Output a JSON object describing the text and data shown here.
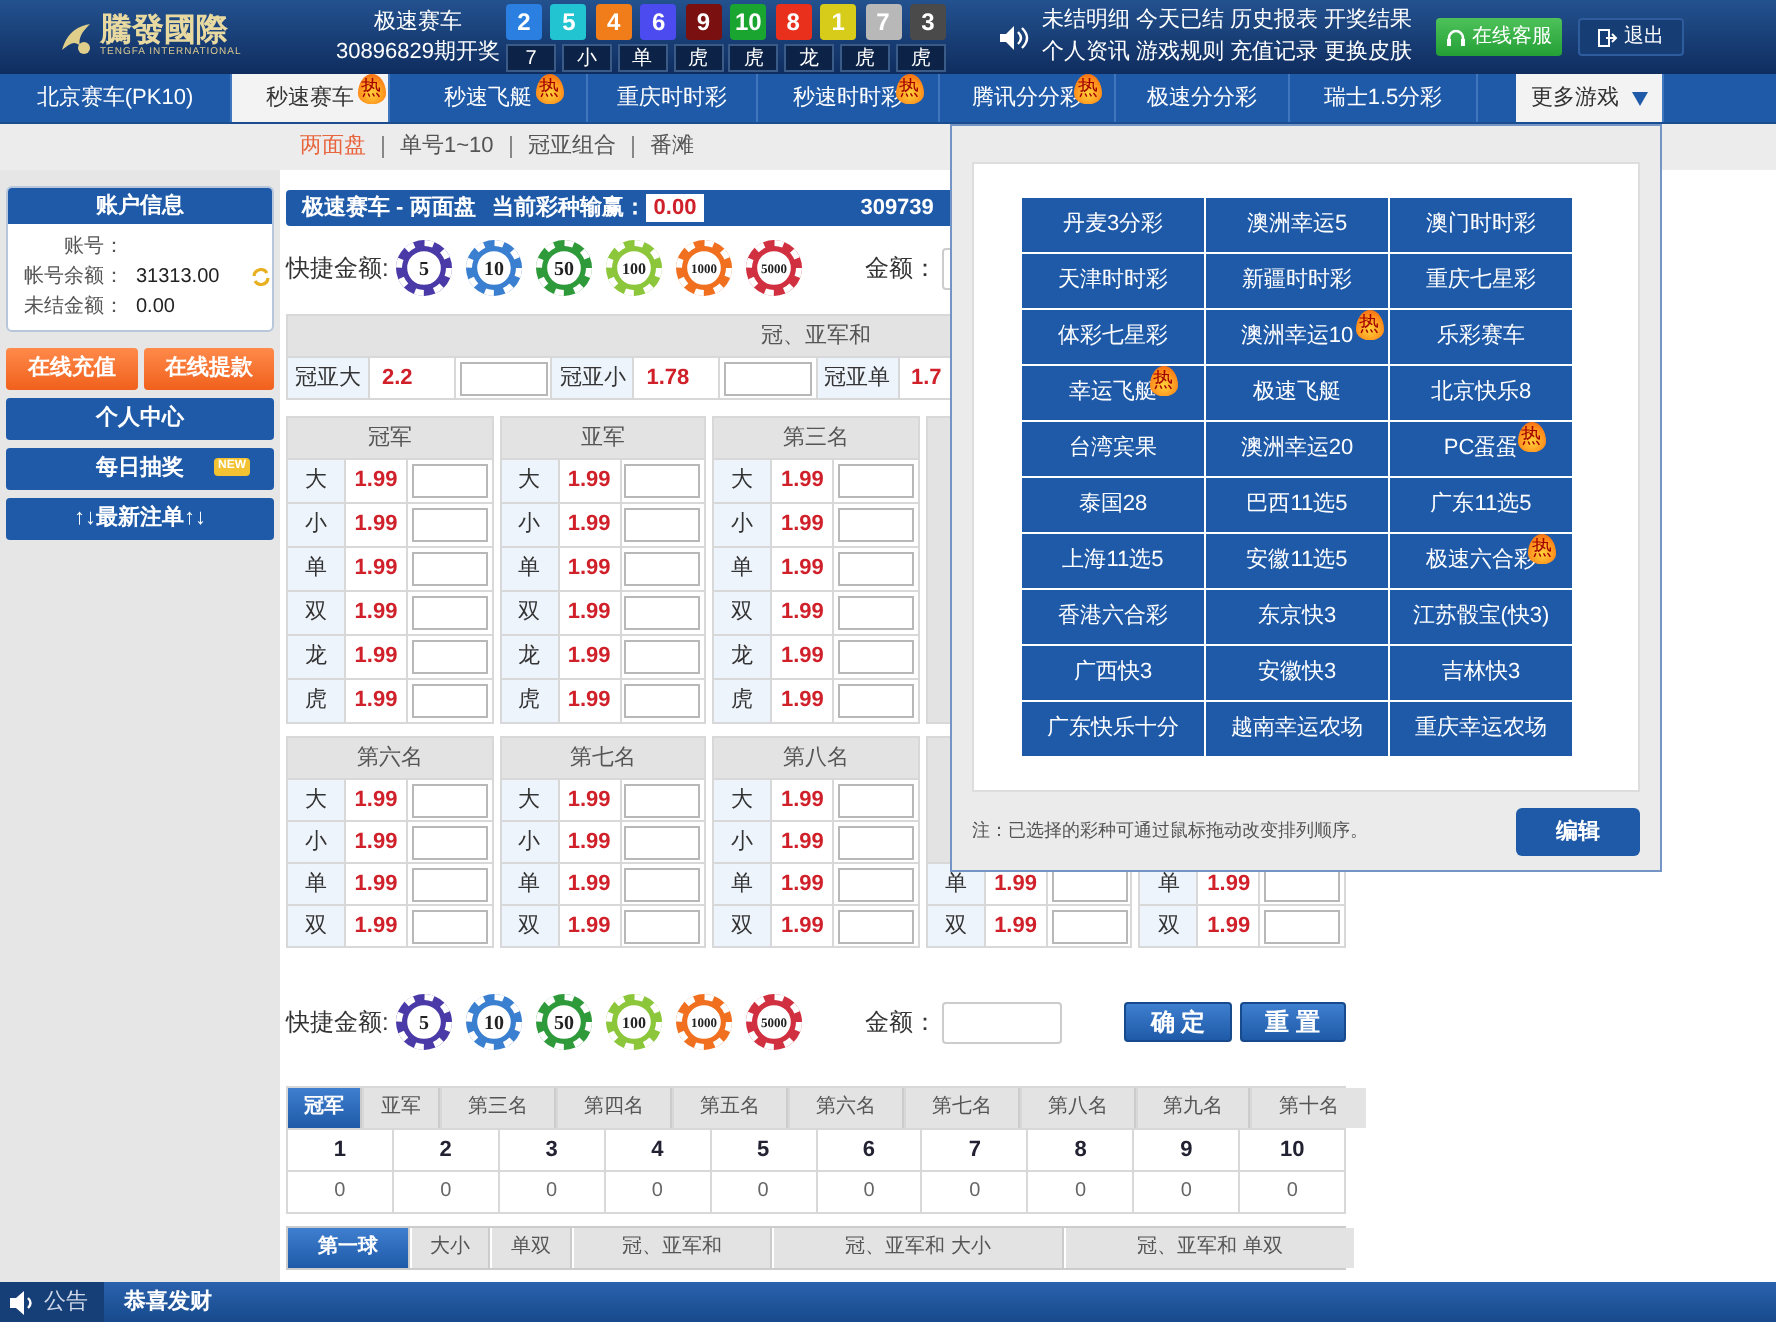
{
  "header": {
    "logo": {
      "name": "騰發國際",
      "subtitle": "TENGFA INTERNATIONAL"
    },
    "draw": {
      "game": "极速赛车",
      "issue": "30896829期开奖"
    },
    "balls": [
      {
        "number": "2",
        "color": "#2b7fe0"
      },
      {
        "number": "5",
        "color": "#22c4d2"
      },
      {
        "number": "4",
        "color": "#f07d1a"
      },
      {
        "number": "6",
        "color": "#4b4bef"
      },
      {
        "number": "9",
        "color": "#7a1010"
      },
      {
        "number": "10",
        "color": "#1aa531"
      },
      {
        "number": "8",
        "color": "#e8301c"
      },
      {
        "number": "1",
        "color": "#d8cc1a"
      },
      {
        "number": "7",
        "color": "#b8b8b8"
      },
      {
        "number": "3",
        "color": "#4a4a4a"
      }
    ],
    "results": [
      "7",
      "小",
      "单",
      "虎",
      "虎",
      "龙",
      "虎",
      "虎"
    ],
    "links": [
      [
        "未结明细",
        "今天已结",
        "历史报表",
        "开奖结果"
      ],
      [
        "个人资讯",
        "游戏规则",
        "充值记录",
        "更换皮肤"
      ]
    ],
    "buttons": [
      {
        "label": "在线客服",
        "kind": "support"
      },
      {
        "label": "退出",
        "kind": "logout"
      }
    ]
  },
  "nav": {
    "tabs": [
      {
        "label": "北京赛车(PK10)",
        "selected": false
      },
      {
        "label": "秒速赛车",
        "selected": true,
        "badge": "热"
      },
      {
        "label": "秒速飞艇",
        "selected": false,
        "badge": "热"
      },
      {
        "label": "重庆时时彩",
        "selected": false
      },
      {
        "label": "秒速时时彩",
        "selected": false,
        "badge": "热"
      },
      {
        "label": "腾讯分分彩",
        "selected": false,
        "badge": "热"
      },
      {
        "label": "极速分分彩",
        "selected": false
      },
      {
        "label": "瑞士1.5分彩",
        "selected": false
      }
    ],
    "more": {
      "label": "更多游戏",
      "expanded": true
    }
  },
  "subnav": [
    {
      "label": "两面盘",
      "selected": true
    },
    {
      "label": "单号1~10",
      "selected": false
    },
    {
      "label": "冠亚组合",
      "selected": false
    },
    {
      "label": "番滩",
      "selected": false
    }
  ],
  "account": {
    "title": "账户信息",
    "rows": [
      {
        "label": "账号："
      },
      {
        "label": "帐号余额：",
        "value": "31313.00",
        "refresh": true
      },
      {
        "label": "未结金额：",
        "value": "0.00"
      }
    ]
  },
  "sidebar_buttons": [
    {
      "label": "在线充值",
      "kind": "accent"
    },
    {
      "label": "在线提款",
      "kind": "accent"
    },
    {
      "label": "个人中心",
      "kind": "menu"
    },
    {
      "label": "每日抽奖",
      "kind": "menu",
      "badge": "NEW"
    },
    {
      "label": "↑↓最新注单↑↓",
      "kind": "menu"
    }
  ],
  "panel": {
    "title": "极速赛车 - 两面盘",
    "winloss_label": "当前彩种输赢：",
    "winloss": "0.00",
    "issue": "309739"
  },
  "quick_top": {
    "label": "快捷金额:",
    "amount_label": "金额：",
    "chips": [
      {
        "value": "5",
        "color": "#4a3aa8"
      },
      {
        "value": "10",
        "color": "#3a7fd0"
      },
      {
        "value": "50",
        "color": "#2e9a3a"
      },
      {
        "value": "100",
        "color": "#8cc63a"
      },
      {
        "value": "1000",
        "color": "#f07020"
      },
      {
        "value": "5000",
        "color": "#d03040"
      }
    ]
  },
  "sum_table": {
    "title": "冠、亚军和",
    "cells": [
      {
        "label": "冠亚大",
        "odds": "2.2"
      },
      {
        "label": "冠亚小",
        "odds": "1.78"
      },
      {
        "label": "冠亚单",
        "odds": "1.7"
      }
    ]
  },
  "groups": [
    {
      "tables": [
        {
          "title": "冠军",
          "rows": [
            {
              "label": "大",
              "odds": "1.99"
            },
            {
              "label": "小",
              "odds": "1.99"
            },
            {
              "label": "单",
              "odds": "1.99"
            },
            {
              "label": "双",
              "odds": "1.99"
            },
            {
              "label": "龙",
              "odds": "1.99"
            },
            {
              "label": "虎",
              "odds": "1.99"
            }
          ]
        },
        {
          "title": "亚军",
          "rows": [
            {
              "label": "大",
              "odds": "1.99"
            },
            {
              "label": "小",
              "odds": "1.99"
            },
            {
              "label": "单",
              "odds": "1.99"
            },
            {
              "label": "双",
              "odds": "1.99"
            },
            {
              "label": "龙",
              "odds": "1.99"
            },
            {
              "label": "虎",
              "odds": "1.99"
            }
          ]
        },
        {
          "title": "第三名",
          "rows": [
            {
              "label": "大",
              "odds": "1.99"
            },
            {
              "label": "小",
              "odds": "1.99"
            },
            {
              "label": "单",
              "odds": "1.99"
            },
            {
              "label": "双",
              "odds": "1.99"
            },
            {
              "label": "龙",
              "odds": "1.99"
            },
            {
              "label": "虎",
              "odds": "1.99"
            }
          ]
        }
      ]
    },
    {
      "tables": [
        {
          "title": "第六名",
          "rows": [
            {
              "label": "大",
              "odds": "1.99"
            },
            {
              "label": "小",
              "odds": "1.99"
            },
            {
              "label": "单",
              "odds": "1.99"
            },
            {
              "label": "双",
              "odds": "1.99"
            }
          ]
        },
        {
          "title": "第七名",
          "rows": [
            {
              "label": "大",
              "odds": "1.99"
            },
            {
              "label": "小",
              "odds": "1.99"
            },
            {
              "label": "单",
              "odds": "1.99"
            },
            {
              "label": "双",
              "odds": "1.99"
            }
          ]
        },
        {
          "title": "第八名",
          "rows": [
            {
              "label": "大",
              "odds": "1.99"
            },
            {
              "label": "小",
              "odds": "1.99"
            },
            {
              "label": "单",
              "odds": "1.99"
            },
            {
              "label": "双",
              "odds": "1.99"
            }
          ]
        },
        {
          "rows": [
            {
              "label": "单",
              "odds": "1.99"
            },
            {
              "label": "双",
              "odds": "1.99"
            }
          ]
        },
        {
          "rows": [
            {
              "label": "单",
              "odds": "1.99"
            },
            {
              "label": "双",
              "odds": "1.99"
            }
          ]
        }
      ]
    }
  ],
  "quick_bottom": {
    "label": "快捷金额:",
    "amount_label": "金额：",
    "chips": [
      {
        "value": "5",
        "color": "#4a3aa8"
      },
      {
        "value": "10",
        "color": "#3a7fd0"
      },
      {
        "value": "50",
        "color": "#2e9a3a"
      },
      {
        "value": "100",
        "color": "#8cc63a"
      },
      {
        "value": "1000",
        "color": "#f07020"
      },
      {
        "value": "5000",
        "color": "#d03040"
      }
    ],
    "buttons": [
      "确 定",
      "重 置"
    ]
  },
  "rank_tabs": [
    {
      "label": "冠军",
      "selected": true
    },
    {
      "label": "亚军",
      "selected": false
    },
    {
      "label": "第三名",
      "selected": false
    },
    {
      "label": "第四名",
      "selected": false
    },
    {
      "label": "第五名",
      "selected": false
    },
    {
      "label": "第六名",
      "selected": false
    },
    {
      "label": "第七名",
      "selected": false
    },
    {
      "label": "第八名",
      "selected": false
    },
    {
      "label": "第九名",
      "selected": false
    },
    {
      "label": "第十名",
      "selected": false
    }
  ],
  "numbers": [
    "1",
    "2",
    "3",
    "4",
    "5",
    "6",
    "7",
    "8",
    "9",
    "10"
  ],
  "counts": [
    "0",
    "0",
    "0",
    "0",
    "0",
    "0",
    "0",
    "0",
    "0",
    "0"
  ],
  "stat_tabs": [
    {
      "label": "第一球",
      "selected": true
    },
    {
      "label": "大小",
      "selected": false
    },
    {
      "label": "单双",
      "selected": false
    },
    {
      "label": "冠、亚军和",
      "selected": false
    },
    {
      "label": "冠、亚军和 大小",
      "selected": false
    },
    {
      "label": "冠、亚军和 单双",
      "selected": false
    }
  ],
  "more_games": {
    "games": [
      {
        "label": "丹麦3分彩"
      },
      {
        "label": "澳洲幸运5"
      },
      {
        "label": "澳门时时彩"
      },
      {
        "label": "天津时时彩"
      },
      {
        "label": "新疆时时彩"
      },
      {
        "label": "重庆七星彩"
      },
      {
        "label": "体彩七星彩"
      },
      {
        "label": "澳洲幸运10",
        "badge": "热"
      },
      {
        "label": "乐彩赛车"
      },
      {
        "label": "幸运飞艇",
        "badge": "热"
      },
      {
        "label": "极速飞艇"
      },
      {
        "label": "北京快乐8"
      },
      {
        "label": "台湾宾果"
      },
      {
        "label": "澳洲幸运20"
      },
      {
        "label": "PC蛋蛋",
        "badge": "热"
      },
      {
        "label": "泰国28"
      },
      {
        "label": "巴西11选5"
      },
      {
        "label": "广东11选5"
      },
      {
        "label": "上海11选5"
      },
      {
        "label": "安徽11选5"
      },
      {
        "label": "极速六合彩",
        "badge": "热"
      },
      {
        "label": "香港六合彩"
      },
      {
        "label": "东京快3"
      },
      {
        "label": "江苏骰宝(快3)"
      },
      {
        "label": "广西快3"
      },
      {
        "label": "安徽快3"
      },
      {
        "label": "吉林快3"
      },
      {
        "label": "广东快乐十分"
      },
      {
        "label": "越南幸运农场"
      },
      {
        "label": "重庆幸运农场"
      }
    ],
    "note": "注：已选择的彩种可通过鼠标拖动改变排列顺序。",
    "button": "编辑"
  },
  "footer": {
    "label": "公告",
    "message": "恭喜发财"
  }
}
